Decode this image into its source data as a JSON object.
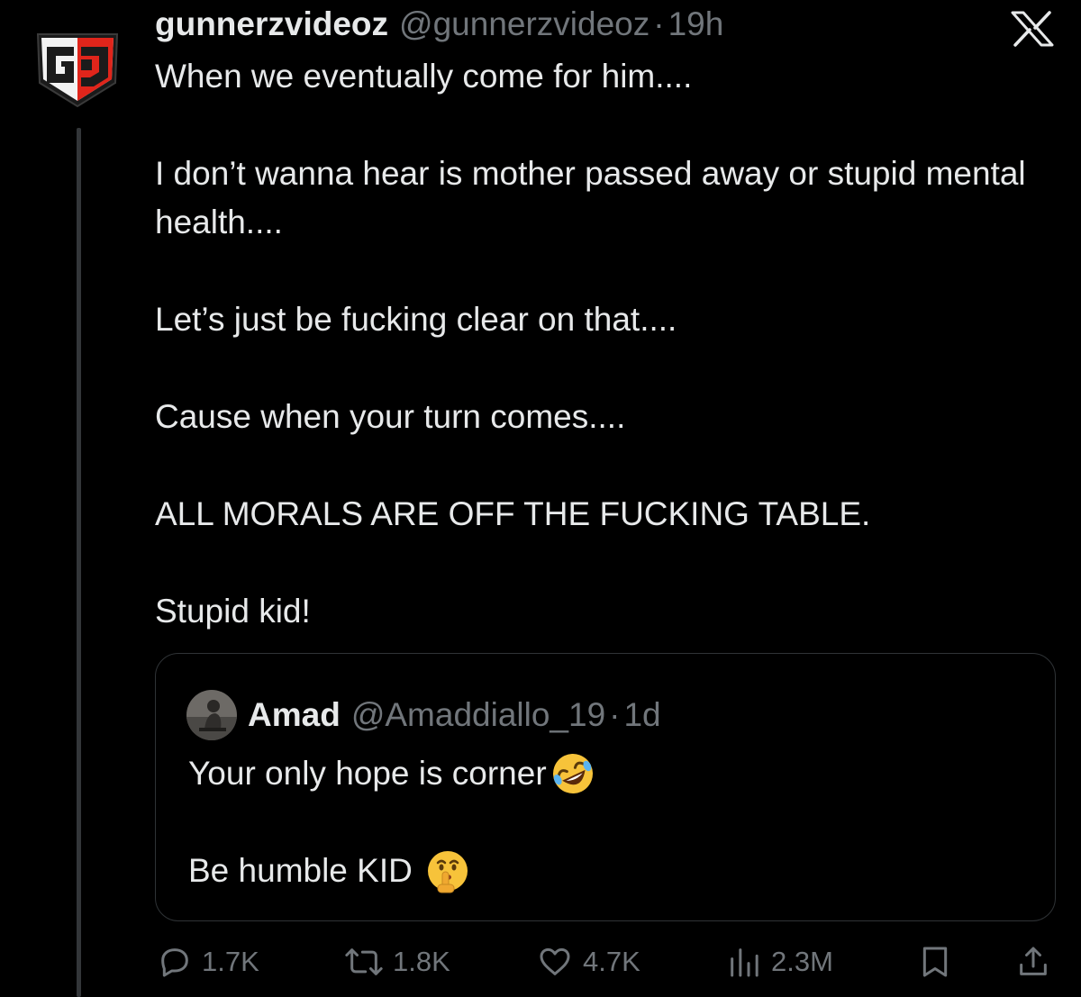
{
  "tweet": {
    "display_name": "gunnerzvideoz",
    "handle": "@gunnerzvideoz",
    "separator": "·",
    "time": "19h",
    "paragraphs": [
      "When we eventually come for him....",
      "I don’t wanna hear is mother passed away or stupid mental health....",
      "Let’s just be fucking clear on that....",
      "Cause when your turn comes....",
      "ALL MORALS ARE OFF THE FUCKING TABLE.",
      "Stupid kid!"
    ]
  },
  "quote": {
    "display_name": "Amad",
    "handle": "@Amaddiallo_19",
    "separator": "·",
    "time": "1d",
    "line1": "Your only hope is corner",
    "line1_emoji": "rolling-on-floor-laughing-emoji",
    "line2": "Be humble KID",
    "line2_emoji": "shushing-face-emoji"
  },
  "actions": {
    "replies": "1.7K",
    "reposts": "1.8K",
    "likes": "4.7K",
    "views": "2.3M"
  },
  "colors": {
    "background": "#000000",
    "text": "#e7e9ea",
    "muted": "#71767b",
    "border": "#2f3336",
    "brand_red": "#e0251b"
  }
}
